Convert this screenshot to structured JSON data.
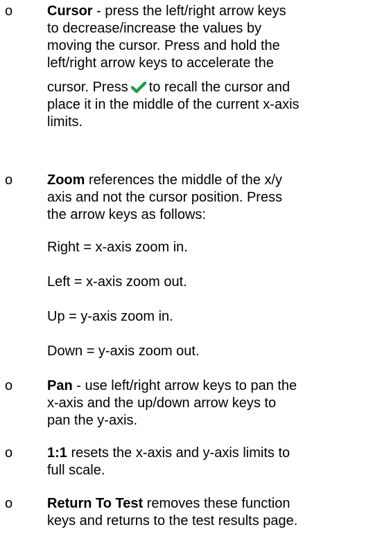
{
  "bullet_symbol": "o",
  "cursor": {
    "title": "Cursor",
    "l1": " - press the left/right arrow keys",
    "l2": "to decrease/increase the values by",
    "l3": "moving the cursor. Press and hold the",
    "l4": "left/right arrow keys to accelerate the",
    "l5a": "cursor. Press",
    "l5b": "to recall the cursor and",
    "l6": "place it in the middle of the current x-axis",
    "l7": "limits.",
    "check_icon": "check-icon",
    "check_color": "#1aa33a"
  },
  "zoom": {
    "title": "Zoom",
    "l1": " references the middle of the x/y",
    "l2": "axis and not the cursor position. Press",
    "l3": "the arrow keys as follows:",
    "right": "Right = x-axis zoom in.",
    "left": "Left = x-axis zoom out.",
    "up": "Up = y-axis zoom in.",
    "down": "Down = y-axis zoom out."
  },
  "pan": {
    "title": "Pan",
    "l1": " - use left/right arrow keys to pan the",
    "l2": "x-axis and the up/down arrow keys to",
    "l3": "pan the y-axis."
  },
  "one_to_one": {
    "title": "1:1",
    "l1": " resets the x-axis and y-axis limits to",
    "l2": "full scale."
  },
  "return_to_test": {
    "title": "Return To Test",
    "l1": " removes these function",
    "l2": "keys and returns to the test results page."
  }
}
